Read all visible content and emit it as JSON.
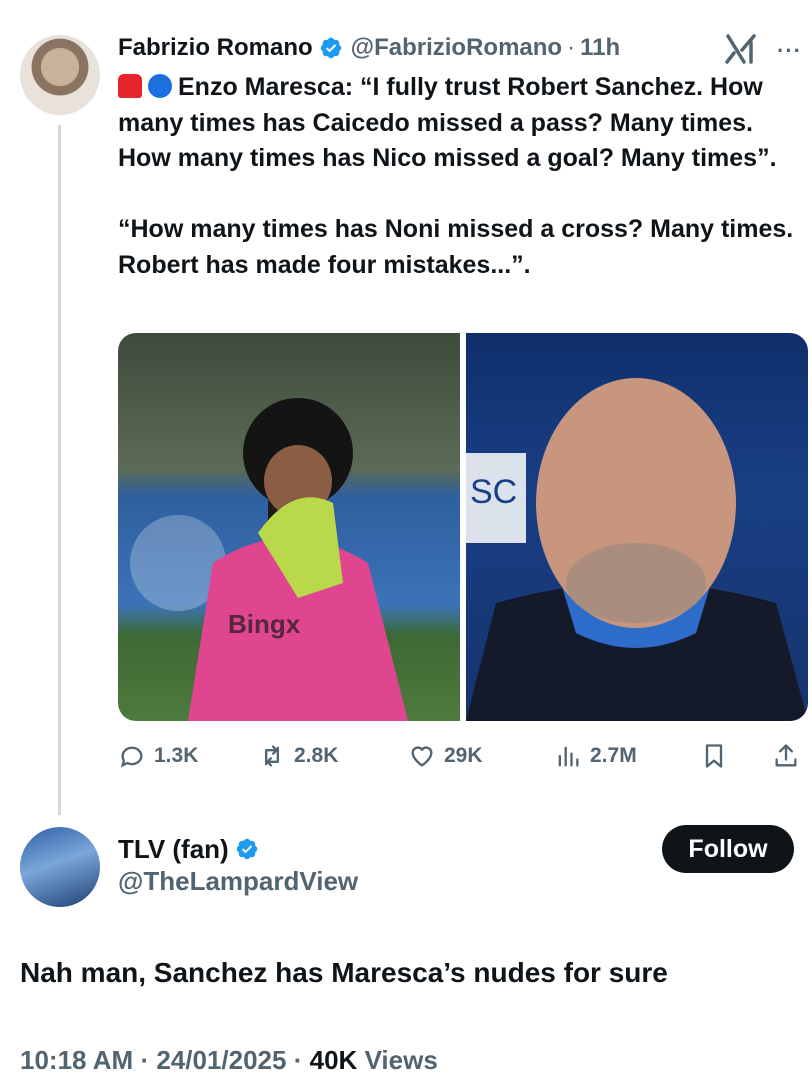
{
  "tweet": {
    "author_name": "Fabrizio Romano",
    "handle": "@FabrizioRomano",
    "separator": "·",
    "time": "11h",
    "more": "···",
    "emoji": [
      "siren-emoji",
      "blue-circle-emoji"
    ],
    "text": "Enzo Maresca: “I fully trust Robert Sanchez. How many times has Caicedo missed a pass? Many times. How many times has Nico missed a goal? Many times”.\n\n“How many times has Noni missed a cross? Many times. Robert has made four mistakes...”.",
    "stats": {
      "replies": "1.3K",
      "reposts": "2.8K",
      "likes": "29K",
      "views": "2.7M"
    }
  },
  "reply": {
    "author_name": "TLV (fan)",
    "handle": "@TheLampardView",
    "follow_label": "Follow",
    "text": "Nah man, Sanchez has Maresca’s nudes for sure",
    "time": "10:18 AM",
    "date": "24/01/2025",
    "views_count": "40K",
    "views_label": "Views",
    "separator": "·"
  },
  "colors": {
    "verified": "#1d9bf0",
    "secondary_text": "#536471",
    "primary_text": "#0f1419",
    "thread_line": "#cfd9de",
    "follow_bg": "#0f1419"
  }
}
